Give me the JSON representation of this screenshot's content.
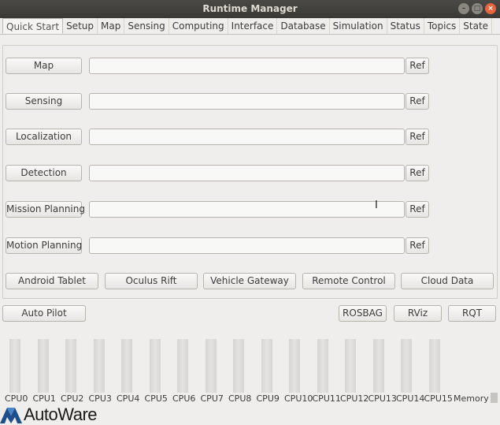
{
  "window": {
    "title": "Runtime Manager"
  },
  "tabs": [
    "Quick Start",
    "Setup",
    "Map",
    "Sensing",
    "Computing",
    "Interface",
    "Database",
    "Simulation",
    "Status",
    "Topics",
    "State"
  ],
  "quick_start": {
    "rows": [
      {
        "label": "Map",
        "value": "",
        "ref": "Ref"
      },
      {
        "label": "Sensing",
        "value": "",
        "ref": "Ref"
      },
      {
        "label": "Localization",
        "value": "",
        "ref": "Ref"
      },
      {
        "label": "Detection",
        "value": "",
        "ref": "Ref"
      },
      {
        "label": "Mission Planning",
        "value": "",
        "ref": "Ref"
      },
      {
        "label": "Motion Planning",
        "value": "",
        "ref": "Ref"
      }
    ],
    "devices": [
      "Android Tablet",
      "Oculus Rift",
      "Vehicle Gateway",
      "Remote Control",
      "Cloud Data"
    ]
  },
  "toolbar": {
    "auto_pilot": "Auto Pilot",
    "rosbag": "ROSBAG",
    "rviz": "RViz",
    "rqt": "RQT"
  },
  "monitor": {
    "cpus": [
      "CPU0",
      "CPU1",
      "CPU2",
      "CPU3",
      "CPU4",
      "CPU5",
      "CPU6",
      "CPU7",
      "CPU8",
      "CPU9",
      "CPU10",
      "CPU11",
      "CPU12",
      "CPU13",
      "CPU14",
      "CPU15"
    ],
    "memory_label": "Memory"
  },
  "logo": {
    "text": "AutoWare"
  }
}
